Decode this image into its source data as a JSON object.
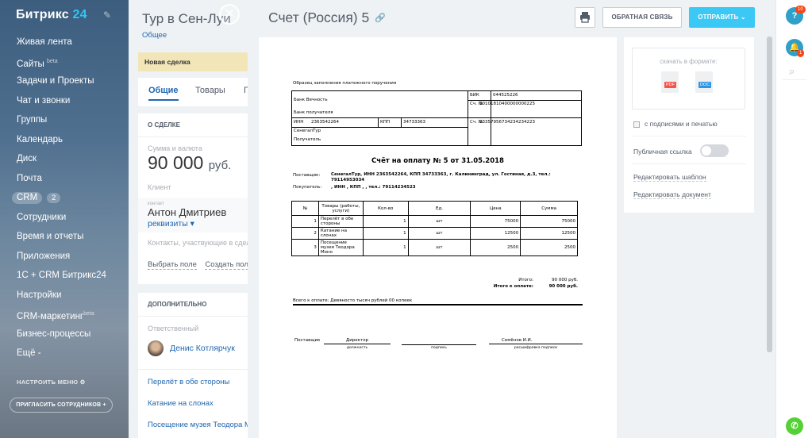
{
  "sidebar": {
    "logo_text": "Битрикс",
    "logo_num": "24",
    "items": [
      {
        "label": "Живая лента"
      },
      {
        "label": "Сайты",
        "sup": "beta"
      },
      {
        "label": "Задачи и Проекты"
      },
      {
        "label": "Чат и звонки"
      },
      {
        "label": "Группы"
      },
      {
        "label": "Календарь"
      },
      {
        "label": "Диск"
      },
      {
        "label": "Почта"
      },
      {
        "label": "CRM",
        "count": "2"
      },
      {
        "label": "Сотрудники"
      },
      {
        "label": "Время и отчеты"
      },
      {
        "label": "Приложения"
      },
      {
        "label": "1С + CRM Битрикс24"
      },
      {
        "label": "Настройки"
      },
      {
        "label": "CRM-маркетинг",
        "sup": "beta"
      },
      {
        "label": "Бизнес-процессы"
      },
      {
        "label": "Ещё -"
      }
    ],
    "setup_menu": "НАСТРОИТЬ МЕНЮ",
    "invite": "ПРИГЛАСИТЬ СОТРУДНИКОВ"
  },
  "deal": {
    "title": "Тур в Сен-Луи",
    "subtitle": "Общее",
    "stage": "Новая сделка",
    "tabs": [
      "Общие",
      "Товары",
      "Г"
    ],
    "about_header": "О СДЕЛКЕ",
    "sum_label": "Сумма и валюта",
    "sum_value": "90 000",
    "sum_currency": "руб.",
    "client_label": "Клиент",
    "contact_label": "контакт",
    "contact_name": "Антон Дмитриев",
    "requisites": "реквизиты",
    "participants": "Контакты, участвующие в сделке",
    "choose_field": "Выбрать поле",
    "create_field": "Создать поле",
    "extra_header": "ДОПОЛНИТЕЛЬНО",
    "responsible_label": "Ответственный",
    "responsible_name": "Денис Котлярчук",
    "products": [
      "Перелёт в обе стороны",
      "Катание на слонах",
      "Посещение музея Теодора М"
    ]
  },
  "panel": {
    "title": "Счет (Россия) 5",
    "feedback": "ОБРАТНАЯ СВЯЗЬ",
    "send": "ОТПРАВИТЬ"
  },
  "invoice": {
    "sample_caption": "Образец заполнения платежного поручения",
    "bank_name": "Банк Вечность",
    "bank_receiver": "Банк получателя",
    "bik_label": "БИК",
    "bik_value": "044525226",
    "acc1_label": "Сч. №",
    "acc1_value": "30101810400000000225",
    "inn_label": "ИНН",
    "inn_value": "2363542264",
    "kpp_label": "КПП",
    "kpp_value": "34733363",
    "acc2_label": "Сч. №",
    "acc2_value": "23357956734234234223",
    "company": "СенегалТур",
    "receiver": "Получатель",
    "title": "Счёт на оплату № 5 от 31.05.2018",
    "supplier_label": "Поставщик:",
    "supplier_value": "СенегалТур, ИНН 2363542264, КПП 34733363, г. Калининград, ул. Гостиная, д.3, тел.: 79114953034",
    "buyer_label": "Покупатель:",
    "buyer_value": ", ИНН , КПП , , тел.: 79114234523",
    "table_headers": [
      "№",
      "Товары (работы, услуги)",
      "Кол-во",
      "Ед.",
      "Цена",
      "Сумма"
    ],
    "rows": [
      {
        "n": "1",
        "name": "Перелёт в обе стороны",
        "qty": "1",
        "unit": "шт",
        "price": "75000",
        "sum": "75000"
      },
      {
        "n": "2",
        "name": "Катание на слонах",
        "qty": "1",
        "unit": "шт",
        "price": "12500",
        "sum": "12500"
      },
      {
        "n": "3",
        "name": "Посещение музея Теодора Моно",
        "qty": "1",
        "unit": "шт",
        "price": "2500",
        "sum": "2500"
      }
    ],
    "total_label": "Итого:",
    "total_value": "90 000 руб.",
    "total_pay_label": "Итого к оплате:",
    "total_pay_value": "90 000 руб.",
    "words": "Всего к оплате: Девяносто тысяч рублей 00 копеек",
    "sign_supplier": "Поставщик",
    "sign_position": "Директор",
    "sign_position_cap": "должность",
    "sign_cap": "подпись",
    "sign_name": "Семёнов И.И.",
    "sign_name_cap": "расшифровка подписи"
  },
  "options": {
    "download_caption": "скачать в формате:",
    "pdf": "PDF",
    "doc": "DOC",
    "with_signatures": "с подписями и печатью",
    "public_link": "Публичная ссылка",
    "edit_template": "Редактировать шаблон",
    "edit_document": "Редактировать документ"
  },
  "rightbar": {
    "help_badge": "10",
    "notify_badge": "1"
  },
  "colors": {
    "accent": "#3bc8f5",
    "link": "#2067b0",
    "badge": "#f54819",
    "phone": "#55d036",
    "help": "#2fa0c9"
  }
}
